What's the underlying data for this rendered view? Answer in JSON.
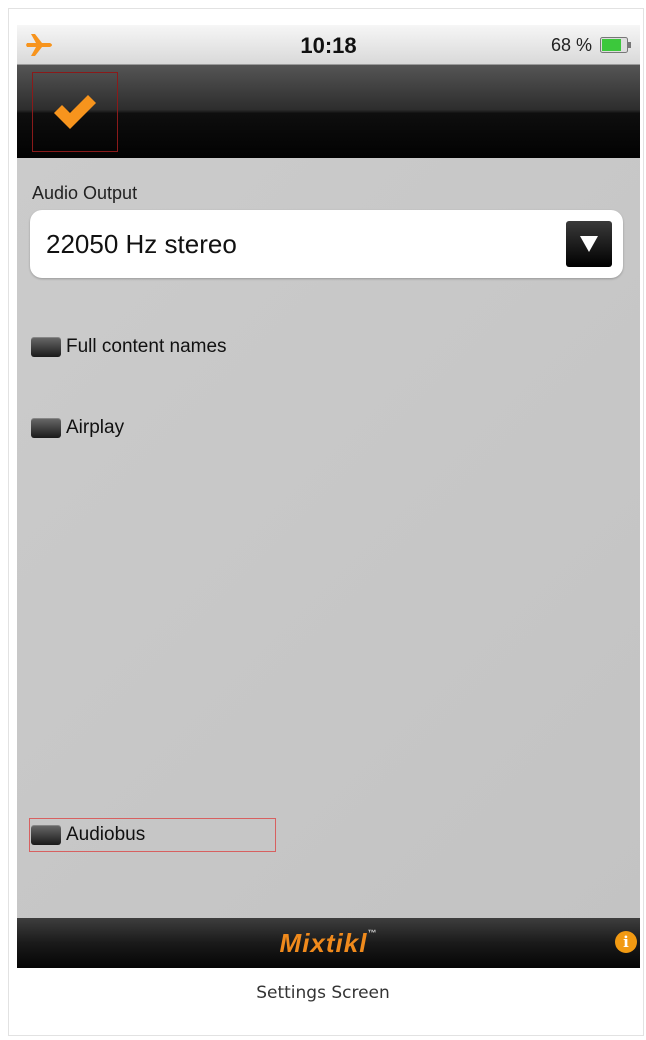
{
  "status_bar": {
    "time": "10:18",
    "battery_percent": "68 %",
    "icons": [
      "airplane-icon",
      "battery-icon"
    ],
    "airplane_color": "#f7941d",
    "battery_color": "#3cc83c"
  },
  "toolbar": {
    "confirm_icon": "checkmark-icon",
    "accent_color": "#f7941d"
  },
  "settings": {
    "audio_output_label": "Audio Output",
    "audio_output_value": "22050 Hz stereo",
    "options": {
      "full_content_names": "Full content names",
      "airplay": "Airplay",
      "audiobus": "Audiobus"
    }
  },
  "footer": {
    "brand": "Mixtikl",
    "brand_tm": "™",
    "info_icon_glyph": "i"
  },
  "caption": "Settings Screen"
}
